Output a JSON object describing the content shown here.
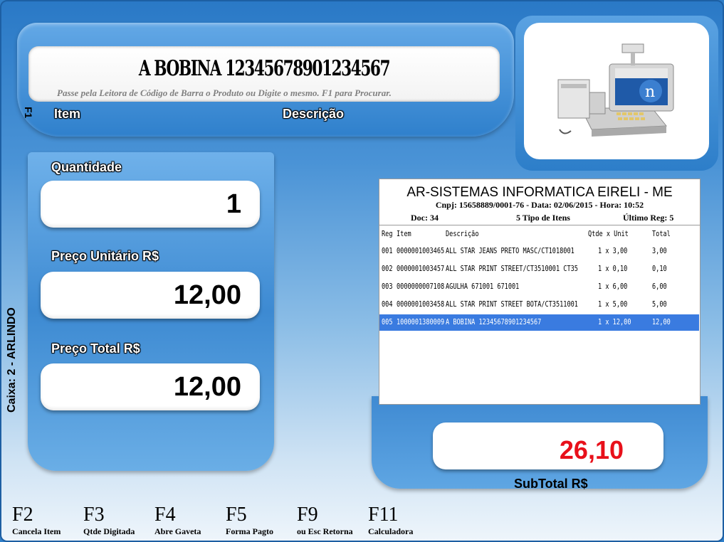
{
  "product": {
    "name": "A BOBINA 12345678901234567",
    "hint": "Passe pela Leitora de Código de Barra o Produto ou Digite o mesmo. F1 para Procurar.",
    "f1": "F1",
    "item_label": "Item",
    "desc_label": "Descrição"
  },
  "fields": {
    "quantidade_label": "Quantidade",
    "quantidade_value": "1",
    "preco_unit_label": "Preço Unitário R$",
    "preco_unit_value": "12,00",
    "preco_total_label": "Preço Total R$",
    "preco_total_value": "12,00"
  },
  "caixa": "Caixa: 2 - ARLINDO",
  "receipt": {
    "company": "AR-SISTEMAS INFORMATICA EIRELI - ME",
    "info": "Cnpj: 15658889/0001-76 - Data: 02/06/2015 - Hora: 10:52",
    "doc": "Doc: 34",
    "tipos": "5 Tipo de Itens",
    "ultimo": "Último Reg:  5",
    "headers": {
      "reg": "Reg",
      "item": "Item",
      "desc": "Descrição",
      "qtde": "Qtde x Unit",
      "total": "Total"
    },
    "rows": [
      {
        "reg": "001",
        "item": "0000001003465",
        "desc": "ALL STAR JEANS PRETO MASC/CT1018001",
        "qtde": "1 x 3,00",
        "total": "3,00"
      },
      {
        "reg": "002",
        "item": "0000001003457",
        "desc": "ALL STAR PRINT STREET/CT3510001 CT35",
        "qtde": "1 x 0,10",
        "total": "0,10"
      },
      {
        "reg": "003",
        "item": "0000000007108",
        "desc": "AGULHA 671001 671001",
        "qtde": "1 x 6,00",
        "total": "6,00"
      },
      {
        "reg": "004",
        "item": "0000001003458",
        "desc": "ALL STAR PRINT STREET BOTA/CT3511001",
        "qtde": "1 x 5,00",
        "total": "5,00"
      },
      {
        "reg": "005",
        "item": "1000001380009",
        "desc": "A BOBINA 12345678901234567",
        "qtde": "1 x 12,00",
        "total": "12,00"
      }
    ]
  },
  "subtotal": {
    "value": "26,10",
    "label": "SubTotal R$"
  },
  "fkeys": [
    {
      "key": "F2",
      "desc": "Cancela Item"
    },
    {
      "key": "F3",
      "desc": "Qtde Digitada"
    },
    {
      "key": "F4",
      "desc": "Abre Gaveta"
    },
    {
      "key": "F5",
      "desc": "Forma Pagto"
    },
    {
      "key": "F9",
      "desc": "ou Esc Retorna"
    },
    {
      "key": "F11",
      "desc": "Calculadora"
    }
  ],
  "colors": {
    "subtotal": "#e8101a",
    "selected_row": "#3a7be0",
    "panel": "#2f80cc"
  },
  "icons": {
    "product_image": "pos-terminal-icon"
  }
}
